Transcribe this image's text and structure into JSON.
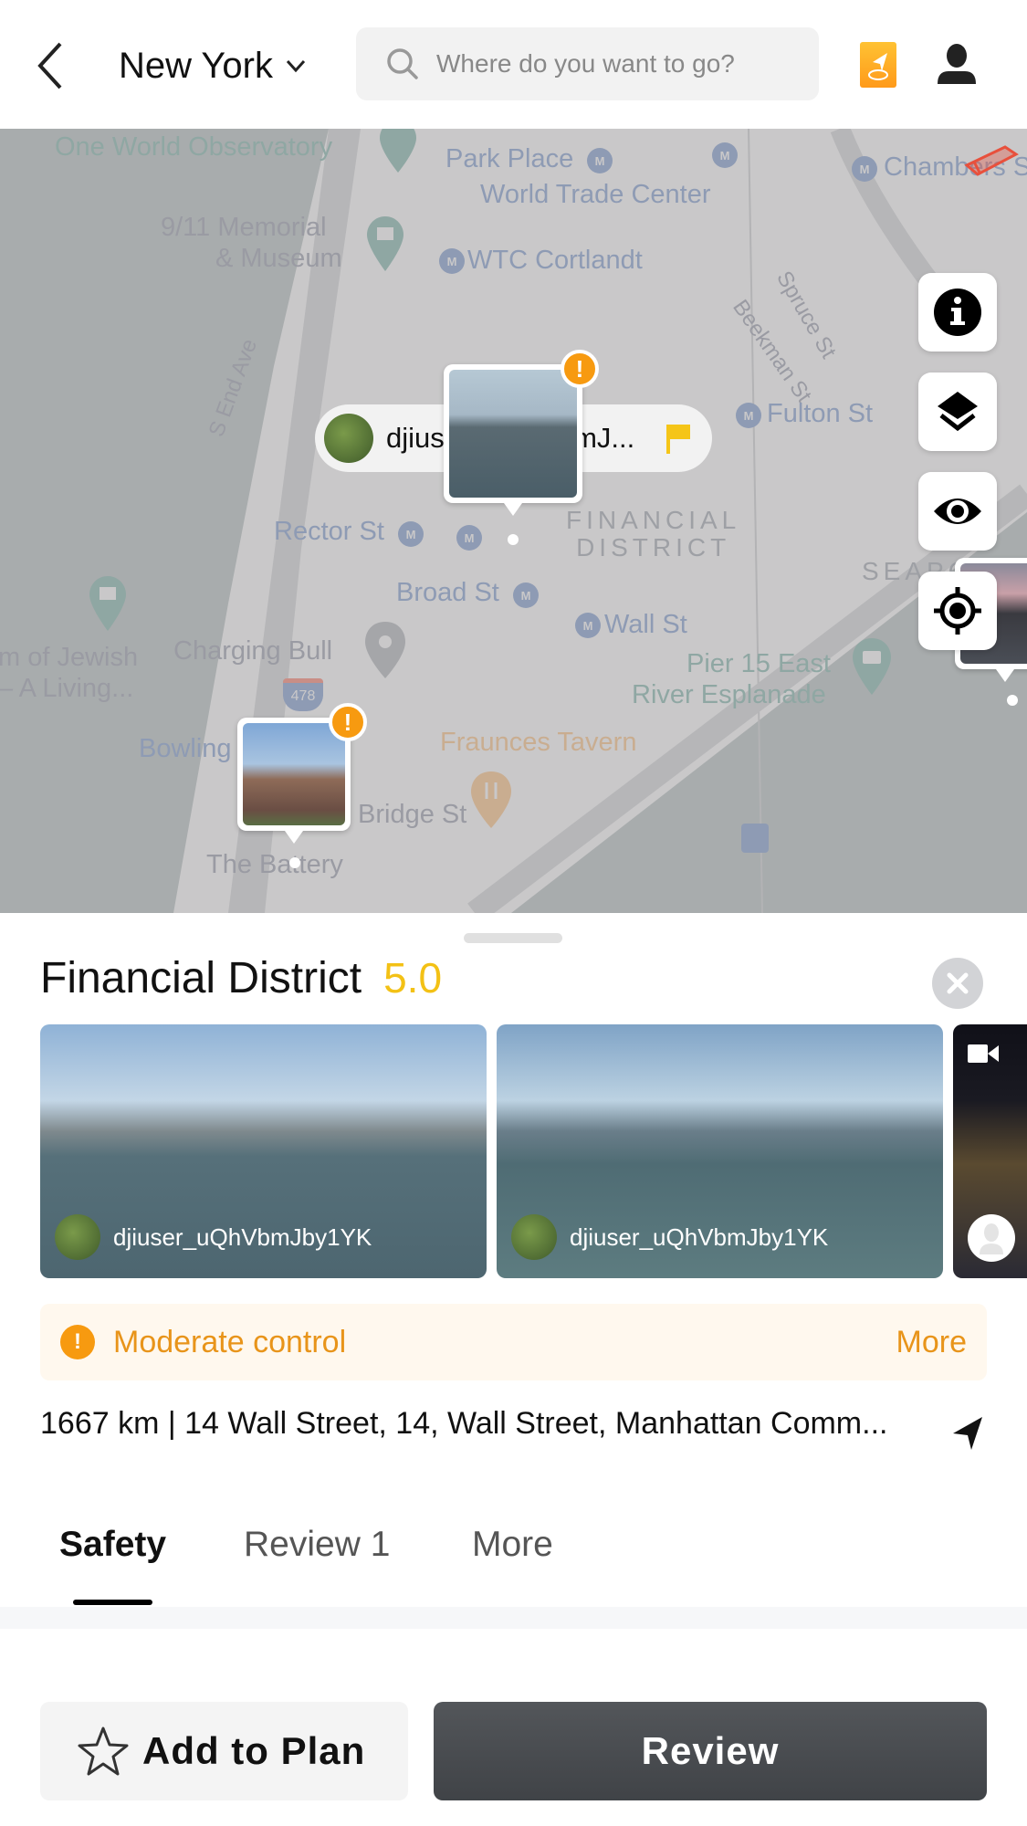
{
  "header": {
    "city": "New York",
    "search_placeholder": "Where do you want to go?"
  },
  "map": {
    "labels": {
      "one_world": "One World Observatory",
      "park_place": "Park Place",
      "wtc": "World Trade Center",
      "memorial_1": "9/11 Memorial",
      "memorial_2": "& Museum",
      "wtc_cortlandt": "WTC Cortlandt",
      "chambers": "Chambers St",
      "s_end_ave": "S End Ave",
      "spruce": "Spruce St",
      "beekman": "Beekman St",
      "fulton": "Fulton St",
      "fulton2": "n St",
      "rector": "Rector St",
      "financial_district_1": "FINANCIAL",
      "financial_district_2": "DISTRICT",
      "seaport": "SEAPO",
      "broad": "Broad St",
      "wall": "Wall St",
      "jewish_1": "m of Jewish",
      "jewish_2": "– A Living...",
      "charging_bull": "Charging Bull",
      "interstate": "478",
      "pier_1": "Pier 15 East",
      "pier_2": "River Esplanade",
      "bowling": "Bowling",
      "fraunces": "Fraunces Tavern",
      "bridge": "Bridge St",
      "battery": "The Battery"
    },
    "user_pill": {
      "username": "djiuser_uQhVbmJ...",
      "flag_color": "#f5c518"
    },
    "warning_badge": "!",
    "controls": [
      "info",
      "layers",
      "visibility",
      "locate"
    ]
  },
  "place": {
    "name": "Financial District",
    "rating": "5.0",
    "photos": [
      {
        "user": "djiuser_uQhVbmJby1YK",
        "type": "photo"
      },
      {
        "user": "djiuser_uQhVbmJby1YK",
        "type": "photo"
      },
      {
        "user": "",
        "type": "video"
      }
    ],
    "alert": {
      "label": "Moderate control",
      "more": "More",
      "color": "#e8941a"
    },
    "address": "1667 km | 14 Wall Street, 14, Wall Street, Manhattan Comm..."
  },
  "tabs": [
    {
      "label": "Safety",
      "active": true
    },
    {
      "label": "Review 1",
      "active": false
    },
    {
      "label": "More",
      "active": false
    }
  ],
  "actions": {
    "add_to_plan": "Add to Plan",
    "review": "Review"
  }
}
